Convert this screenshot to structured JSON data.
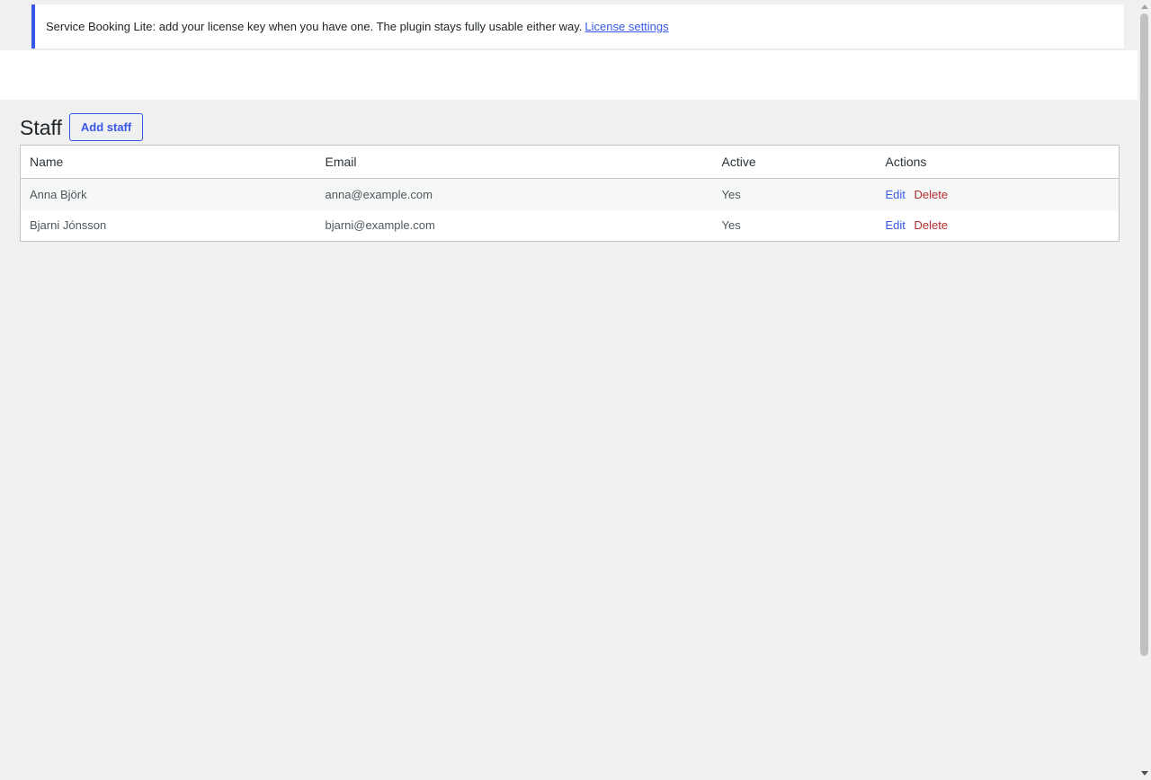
{
  "notice": {
    "text": "Service Booking Lite: add your license key when you have one. The plugin stays fully usable either way.",
    "link_label": "License settings"
  },
  "page": {
    "title": "Staff",
    "add_button_label": "Add staff"
  },
  "table": {
    "columns": [
      "Name",
      "Email",
      "Active",
      "Actions"
    ],
    "rows": [
      {
        "name": "Anna Björk",
        "email": "anna@example.com",
        "active": "Yes",
        "edit": "Edit",
        "delete": "Delete"
      },
      {
        "name": "Bjarni Jónsson",
        "email": "bjarni@example.com",
        "active": "Yes",
        "edit": "Edit",
        "delete": "Delete"
      }
    ]
  },
  "colors": {
    "accent": "#3858e9",
    "danger": "#b32d2e",
    "background": "#f0f0f1"
  }
}
